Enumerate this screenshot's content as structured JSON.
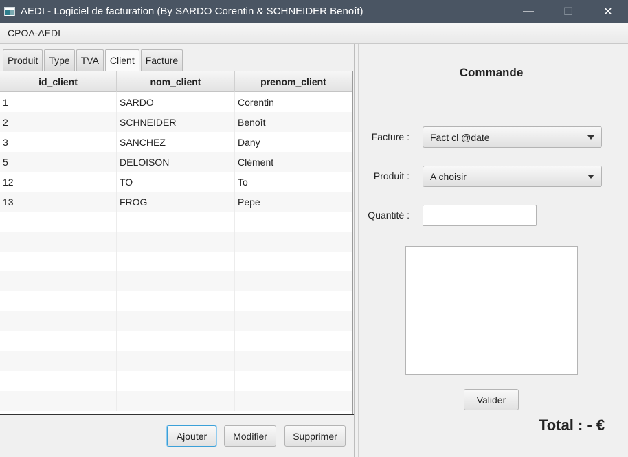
{
  "window": {
    "title": "AEDI - Logiciel de facturation (By SARDO Corentin & SCHNEIDER Benoît)",
    "minimize_glyph": "—",
    "maximize_glyph": "☐",
    "close_glyph": "✕"
  },
  "menu": {
    "items": [
      "CPOA-AEDI"
    ]
  },
  "tabs": [
    {
      "label": "Produit",
      "active": false
    },
    {
      "label": "Type",
      "active": false
    },
    {
      "label": "TVA",
      "active": false
    },
    {
      "label": "Client",
      "active": true
    },
    {
      "label": "Facture",
      "active": false
    }
  ],
  "table": {
    "headers": [
      "id_client",
      "nom_client",
      "prenom_client"
    ],
    "rows": [
      [
        "1",
        "SARDO",
        "Corentin"
      ],
      [
        "2",
        "SCHNEIDER",
        "Benoît"
      ],
      [
        "3",
        "SANCHEZ",
        "Dany"
      ],
      [
        "5",
        "DELOISON",
        "Clément"
      ],
      [
        "12",
        "TO",
        "To"
      ],
      [
        "13",
        "FROG",
        "Pepe"
      ]
    ],
    "empty_rows": 10
  },
  "actions": {
    "ajouter": "Ajouter",
    "modifier": "Modifier",
    "supprimer": "Supprimer"
  },
  "commande": {
    "title": "Commande",
    "facture_label": "Facture :",
    "facture_value": "Fact cl @date",
    "produit_label": "Produit :",
    "produit_value": "A choisir",
    "quantite_label": "Quantité :",
    "quantite_value": "",
    "valider": "Valider",
    "total": "Total : - €"
  }
}
